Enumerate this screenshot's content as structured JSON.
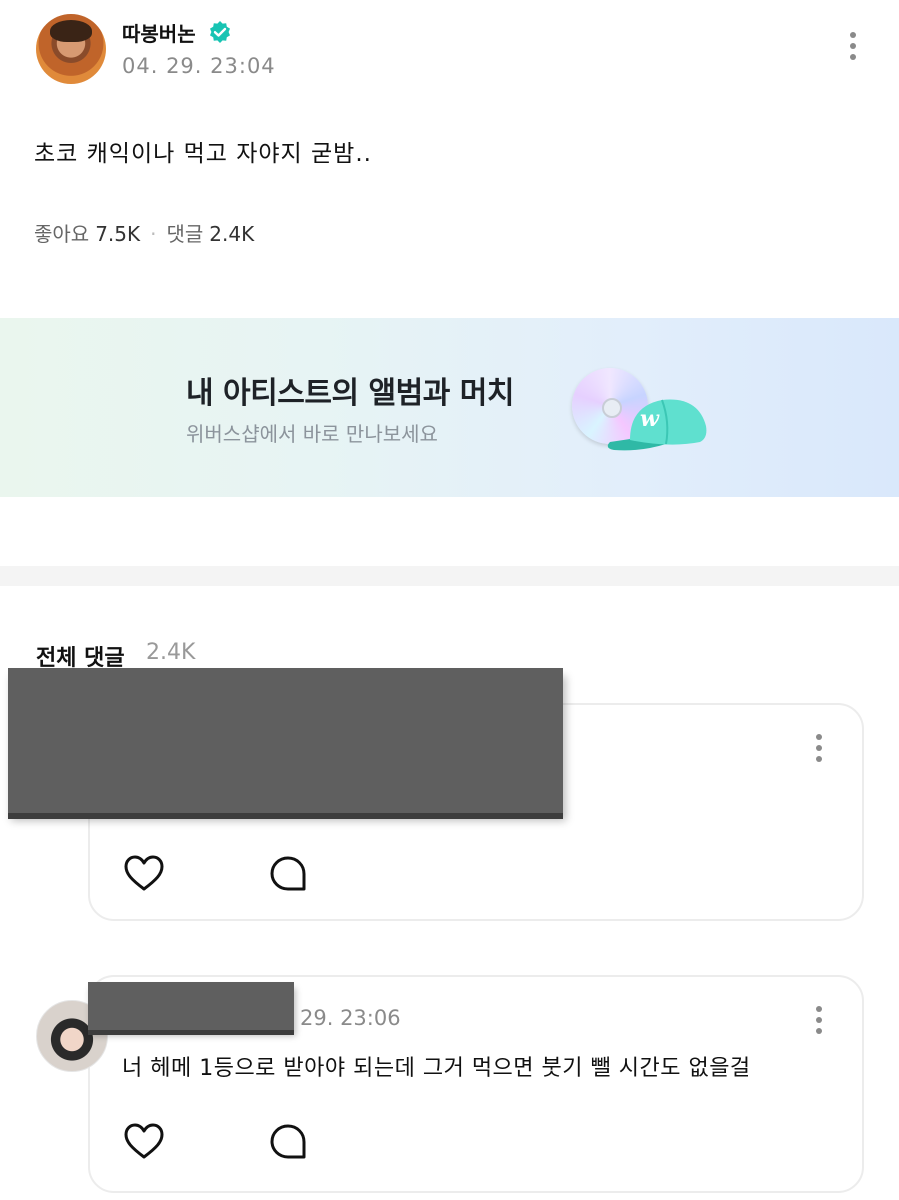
{
  "post": {
    "author": "따봉버논",
    "time": "04. 29. 23:04",
    "body": "초코 캐익이나 먹고 자야지 굳밤..",
    "likes_label": "좋아요",
    "likes_count": "7.5K",
    "comments_label": "댓글",
    "comments_count": "2.4K"
  },
  "banner": {
    "title": "내 아티스트의 앨범과 머치",
    "subtitle": "위버스샵에서 바로 만나보세요"
  },
  "comments_section": {
    "title": "전체 댓글",
    "count": "2.4K"
  },
  "comments": [
    {
      "time": "",
      "text": ""
    },
    {
      "time": "29. 23:06",
      "text": "너 헤메 1등으로 받아야 되는데 그거 먹으면 붓기 뺄 시간도 없을걸"
    }
  ],
  "colors": {
    "verified": "#18c4b3",
    "banner_gradient_start": "#eaf6ee",
    "banner_gradient_end": "#d9e8fb",
    "redaction": "#5f5f5f"
  }
}
